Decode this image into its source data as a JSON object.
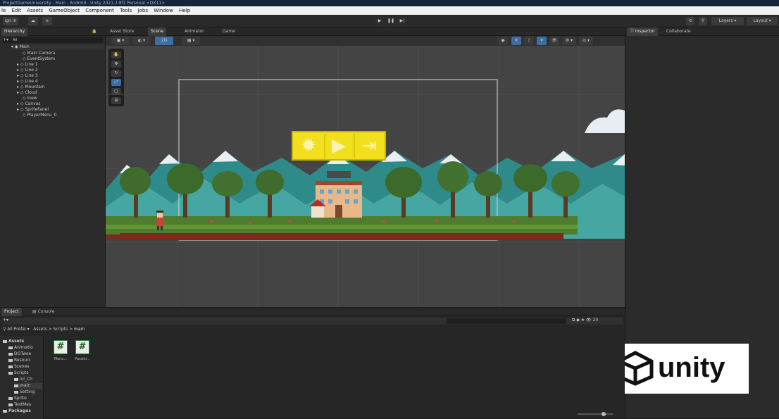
{
  "window": {
    "title": "ProjectGameUniversity - Main - Android - Unity 2021.2.8f1 Personal <DX11>"
  },
  "menu": [
    "le",
    "Edit",
    "Assets",
    "GameObject",
    "Component",
    "Tools",
    "Jobs",
    "Window",
    "Help"
  ],
  "toolbar": {
    "account": "ign in",
    "layers": "Layers",
    "layout": "Layout"
  },
  "hierarchy": {
    "tab": "Hierarchy",
    "search": "All",
    "root": "Main",
    "items": [
      "Main Camera",
      "EventSystem",
      "Line 1",
      "Line 2",
      "Line 3",
      "Line 4",
      "Mountain",
      "Cloud",
      "Inew",
      "Canvas",
      "SpriteFanel",
      "PlayerMenu_0"
    ]
  },
  "scene_tabs": [
    "Asset Store",
    "Scene",
    "Animator",
    "Game"
  ],
  "inspector_tabs": [
    "Inspector",
    "Collaborate"
  ],
  "bottom": {
    "tabs": [
      "Project",
      "Console"
    ],
    "filter": "All Prefal",
    "breadcrumb": [
      "Assets",
      "Scripts",
      "main"
    ],
    "folders": [
      "Assets",
      "Animatio",
      "DOTwee",
      "Resourc",
      "Scenes",
      "Scripts",
      "lvl_Ch",
      "main",
      "Setting",
      "Sprite",
      "TextMes",
      "Packages"
    ],
    "assets": [
      {
        "icon": "#",
        "label": "Menu..."
      },
      {
        "icon": "#",
        "label": "Paralel..."
      }
    ],
    "item_count": "20"
  },
  "logo": {
    "text": "unity"
  },
  "colors": {
    "accent": "#3d6fa5",
    "yellow": "#f2e01e",
    "grass": "#4f7c2d",
    "mountain": "#3f9a96",
    "snow": "#e8eef2"
  }
}
